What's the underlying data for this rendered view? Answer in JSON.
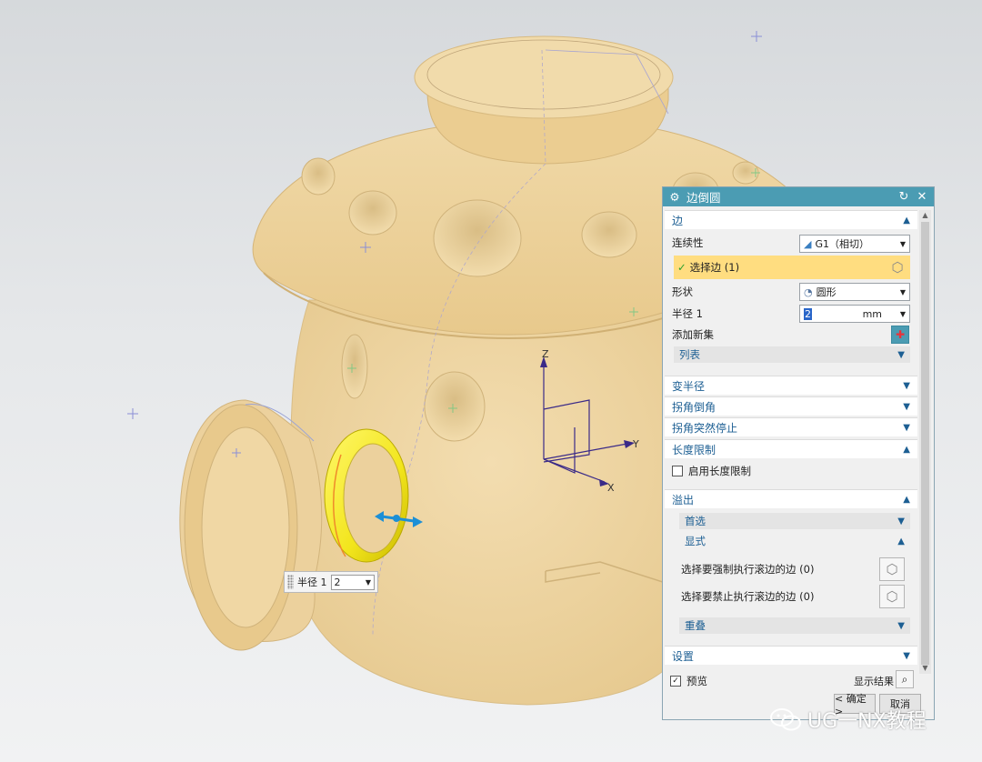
{
  "dialog": {
    "title": "边倒圆",
    "sections": {
      "edge": "边",
      "variable_radius": "变半径",
      "corner_setback": "拐角倒角",
      "stop_short": "拐角突然停止",
      "length_limit": "长度限制",
      "overflow": "溢出",
      "settings": "设置"
    },
    "continuity_label": "连续性",
    "continuity_value": "G1（相切）",
    "select_edge_label": "选择边 (1)",
    "shape_label": "形状",
    "shape_value": "圆形",
    "radius_label": "半径 1",
    "radius_value": "2",
    "radius_unit": "mm",
    "add_new_set_label": "添加新集",
    "list_label": "列表",
    "enable_length_limit_label": "启用长度限制",
    "preferred_label": "首选",
    "explicit_label": "显式",
    "force_rolling_label": "选择要强制执行滚边的边 (0)",
    "prohibit_rolling_label": "选择要禁止执行滚边的边 (0)",
    "overlap_label": "重叠",
    "preview_label": "预览",
    "preview_checked": true,
    "show_result_label": "显示结果",
    "ok_label": "< 确定 >",
    "cancel_label": "取消"
  },
  "viewport": {
    "inline_radius_label": "半径 1",
    "inline_radius_value": "2",
    "axis_x": "X",
    "axis_y": "Y",
    "axis_z": "Z"
  },
  "watermark": "UG一NX教程",
  "colors": {
    "titlebar": "#4b9cb3",
    "section_text": "#1d5f93",
    "selection_highlight": "#ffdd80",
    "model": "#efd7a3",
    "fillet_preview": "#f2e51c"
  }
}
